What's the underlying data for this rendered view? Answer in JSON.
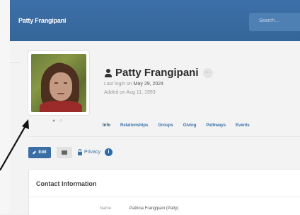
{
  "header": {
    "app_title": "Patty Frangipani",
    "search_placeholder": "Search..."
  },
  "profile": {
    "name": "Patty Frangipani",
    "more_label": "···",
    "last_login_prefix": "Last login on ",
    "last_login_date": "May 29, 2024",
    "added_text": "Added on Aug 11, 1993",
    "photo_pager": "● ○"
  },
  "tabs": [
    {
      "label": "Info"
    },
    {
      "label": "Relationships"
    },
    {
      "label": "Groups"
    },
    {
      "label": "Giving"
    },
    {
      "label": "Pathways"
    },
    {
      "label": "Events"
    }
  ],
  "actions": {
    "edit_label": "Edit",
    "privacy_label": "Privacy",
    "info_label": "i"
  },
  "contact": {
    "title": "Contact Information",
    "name_label": "Name",
    "name_value": "Patricia Frangipani (Patty)"
  },
  "colors": {
    "header_bg": "#3b6ea5",
    "link": "#3a6fa8"
  }
}
